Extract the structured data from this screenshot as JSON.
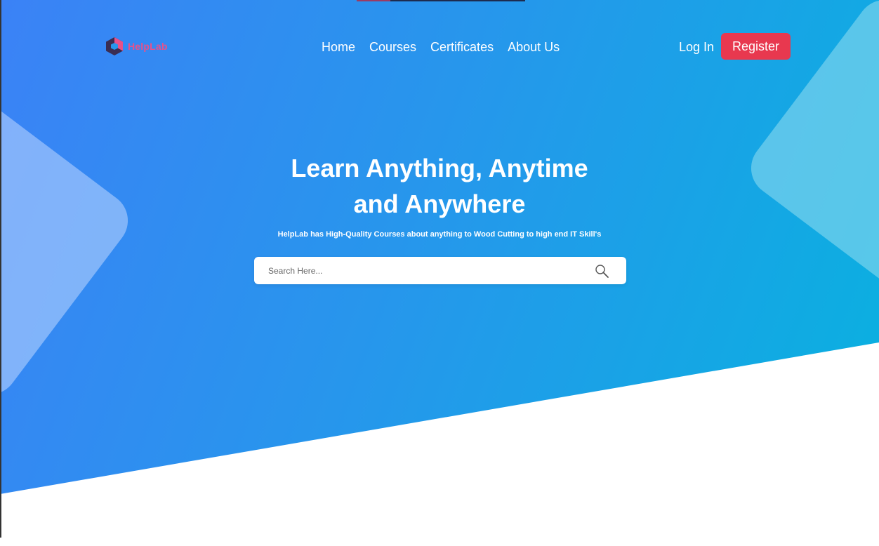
{
  "brand": {
    "name": "HelpLab",
    "logo_icon": "hexagon-logo-icon",
    "colors": {
      "logo_pink": "#e8518a",
      "logo_dark": "#3a2d52"
    }
  },
  "nav": {
    "items": [
      {
        "label": "Home"
      },
      {
        "label": "Courses"
      },
      {
        "label": "Certificates"
      },
      {
        "label": "About Us"
      }
    ],
    "login_label": "Log In",
    "register_label": "Register"
  },
  "hero": {
    "title_line1": "Learn Anything, Anytime",
    "title_line2": "and Anywhere",
    "subtitle": "HelpLab has High-Quality Courses about anything to Wood Cutting  to  high end IT Skill's",
    "search_placeholder": "Search Here...",
    "search_icon": "search-icon"
  },
  "colors": {
    "gradient_start": "#3b82f6",
    "gradient_end": "#08b2df",
    "accent": "#e8384f",
    "text_on_hero": "#ffffff"
  }
}
